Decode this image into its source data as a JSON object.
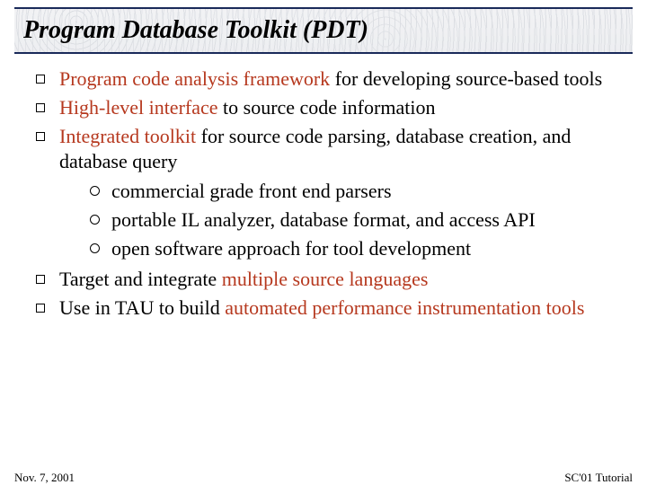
{
  "title": "Program Database Toolkit (PDT)",
  "bullets": [
    {
      "pre": "",
      "hl": "Program code analysis framework",
      "post": " for developing source-based tools"
    },
    {
      "pre": "",
      "hl": "High-level interface",
      "post": " to source code information"
    },
    {
      "pre": "",
      "hl": "Integrated toolkit",
      "post": " for source code parsing, database creation, and database query",
      "sub": [
        "commercial grade front end parsers",
        "portable IL analyzer, database format, and access API",
        "open software approach for tool development"
      ]
    },
    {
      "pre": "Target and integrate ",
      "hl": "multiple source languages",
      "post": ""
    },
    {
      "pre": "Use in TAU to build ",
      "hl": "automated performance instrumentation tools",
      "post": ""
    }
  ],
  "footer": {
    "left": "Nov. 7, 2001",
    "right": "SC'01 Tutorial"
  }
}
